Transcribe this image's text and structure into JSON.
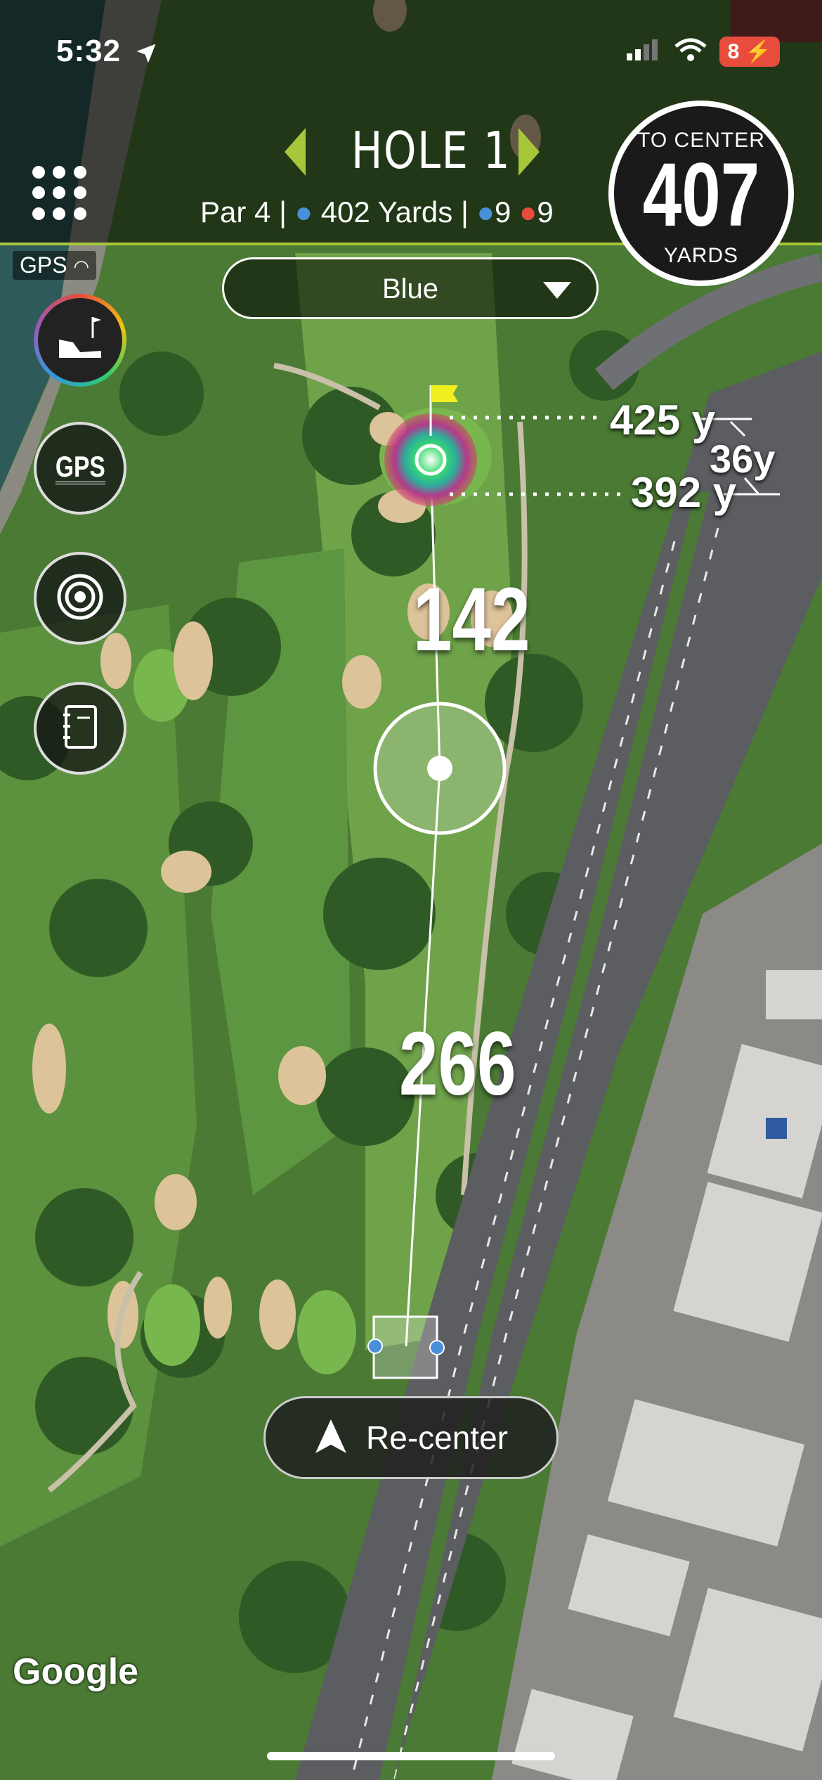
{
  "status_bar": {
    "time": "5:32",
    "battery": "8"
  },
  "header": {
    "hole_title": "HOLE 1",
    "par": "Par 4",
    "yards": "402 Yards",
    "hcp_blue": "9",
    "hcp_red": "9",
    "accent_color": "#a8c63a"
  },
  "to_center": {
    "label_top": "TO CENTER",
    "value": "407",
    "label_bottom": "YARDS"
  },
  "gps_status": "GPS",
  "tee_select": {
    "selected": "Blue"
  },
  "side_buttons": [
    {
      "name": "scorecard-button",
      "icon": "golf-shoe-flag-icon"
    },
    {
      "name": "gps-button",
      "icon": "gps-text-icon",
      "label": "GPS"
    },
    {
      "name": "target-button",
      "icon": "target-rings-icon"
    },
    {
      "name": "notebook-button",
      "icon": "notebook-icon"
    }
  ],
  "green": {
    "back": "425 y",
    "front": "392 y",
    "depth": "36y"
  },
  "distances": {
    "to_target": "142",
    "from_tee": "266"
  },
  "recenter_label": "Re-center",
  "map_attribution": "Google"
}
